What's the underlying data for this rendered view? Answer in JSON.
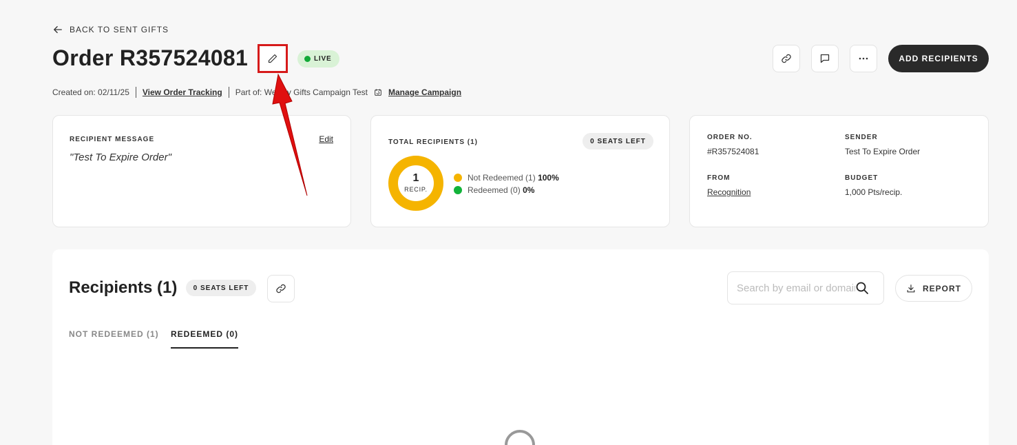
{
  "header": {
    "back_label": "BACK TO SENT GIFTS",
    "title": "Order R357524081",
    "status": "LIVE",
    "add_recipients_label": "ADD RECIPIENTS"
  },
  "meta": {
    "created_on": "Created on: 02/11/25",
    "view_tracking": "View Order Tracking",
    "part_of": "Part of: Weekly Gifts Campaign Test",
    "manage_campaign": "Manage Campaign"
  },
  "message_card": {
    "label": "RECIPIENT MESSAGE",
    "edit": "Edit",
    "text": "\"Test To Expire Order\""
  },
  "recipients_card": {
    "label": "TOTAL RECIPIENTS (1)",
    "seats": "0 SEATS LEFT",
    "count": "1",
    "count_unit": "RECIP.",
    "legend": [
      {
        "label": "Not Redeemed (1)",
        "pct": "100%",
        "color": "#f5b400"
      },
      {
        "label": "Redeemed (0)",
        "pct": "0%",
        "color": "#12b33a"
      }
    ]
  },
  "order_card": {
    "order_no_label": "ORDER NO.",
    "order_no": "#R357524081",
    "sender_label": "SENDER",
    "sender": "Test To Expire Order",
    "from_label": "FROM",
    "from": "Recognition",
    "budget_label": "BUDGET",
    "budget": "1,000 Pts/recip."
  },
  "recipients_panel": {
    "title": "Recipients (1)",
    "seats": "0 SEATS LEFT",
    "search_placeholder": "Search by email or domain",
    "report_label": "REPORT",
    "tabs": [
      {
        "label": "NOT REDEEMED (1)",
        "active": false
      },
      {
        "label": "REDEEMED (0)",
        "active": true
      }
    ]
  },
  "colors": {
    "accent_dark": "#2a2a2a",
    "live_bg": "#d9f2d6",
    "live_dot": "#12a937",
    "donut": "#f5b400",
    "annotation": "#d61a1a"
  }
}
